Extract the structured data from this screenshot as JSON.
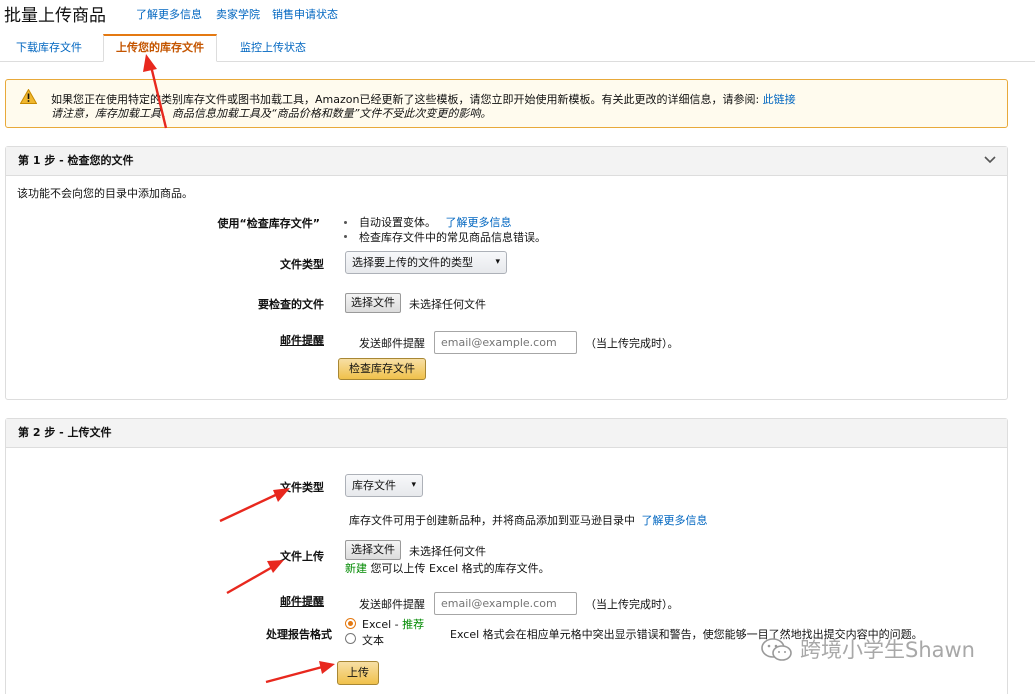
{
  "header": {
    "title": "批量上传商品",
    "links": [
      "了解更多信息",
      "卖家学院",
      "销售申请状态"
    ]
  },
  "tabs": [
    {
      "label": "下载库存文件",
      "active": false
    },
    {
      "label": "上传您的库存文件",
      "active": true
    },
    {
      "label": "监控上传状态",
      "active": false
    }
  ],
  "alert": {
    "icon": "warning-icon",
    "line1": "如果您正在使用特定的类别库存文件或图书加载工具，Amazon已经更新了这些模板，请您立即开始使用新模板。有关此更改的详细信息，请参阅:",
    "line1_link": "此链接",
    "line2": "请注意，库存加载工具、商品信息加载工具及“商品价格和数量”文件不受此次变更的影响。"
  },
  "step1": {
    "title": "第 1 步 - 检查您的文件",
    "description": "该功能不会向您的目录中添加商品。",
    "use_label": "使用“检查库存文件”",
    "bullet1": "自动设置变体。",
    "bullet1_link": "了解更多信息",
    "bullet2": "检查库存文件中的常见商品信息错误。",
    "file_type_label": "文件类型",
    "file_type_select": "选择要上传的文件的类型",
    "file_check_label": "要检查的文件",
    "choose_file_button": "选择文件",
    "no_file_text": "未选择任何文件",
    "email_label": "邮件提醒",
    "email_prefix": "发送邮件提醒",
    "email_placeholder": "email@example.com",
    "email_suffix": "（当上传完成时）。",
    "check_button": "检查库存文件"
  },
  "step2": {
    "title": "第 2 步 - 上传文件",
    "file_type_label": "文件类型",
    "file_type_select": "库存文件",
    "file_type_help": "库存文件可用于创建新品种，并将商品添加到亚马逊目录中",
    "file_type_help_link": "了解更多信息",
    "upload_label": "文件上传",
    "choose_file_button": "选择文件",
    "no_file_text": "未选择任何文件",
    "new_badge": "新建",
    "upload_note": "您可以上传 Excel 格式的库存文件。",
    "email_label": "邮件提醒",
    "email_prefix": "发送邮件提醒",
    "email_placeholder": "email@example.com",
    "email_suffix": "（当上传完成时）。",
    "report_label": "处理报告格式",
    "option_excel": "Excel",
    "option_excel_sep": " - ",
    "option_excel_recommended": "推荐",
    "option_text": "文本",
    "report_help": "Excel 格式会在相应单元格中突出显示错误和警告，使您能够一目了然地找出提交内容中的问题。",
    "upload_button": "上传"
  },
  "watermark": "跨境小学生Shawn",
  "colors": {
    "link": "#0066c0",
    "active_tab": "#c45500",
    "tab_accent": "#e47911",
    "new_green": "#008a00",
    "alert_border": "#e8a93a",
    "alert_bg": "#fffbee",
    "button_yellow": "#f0c14b",
    "annotation_red": "#e8281e"
  }
}
